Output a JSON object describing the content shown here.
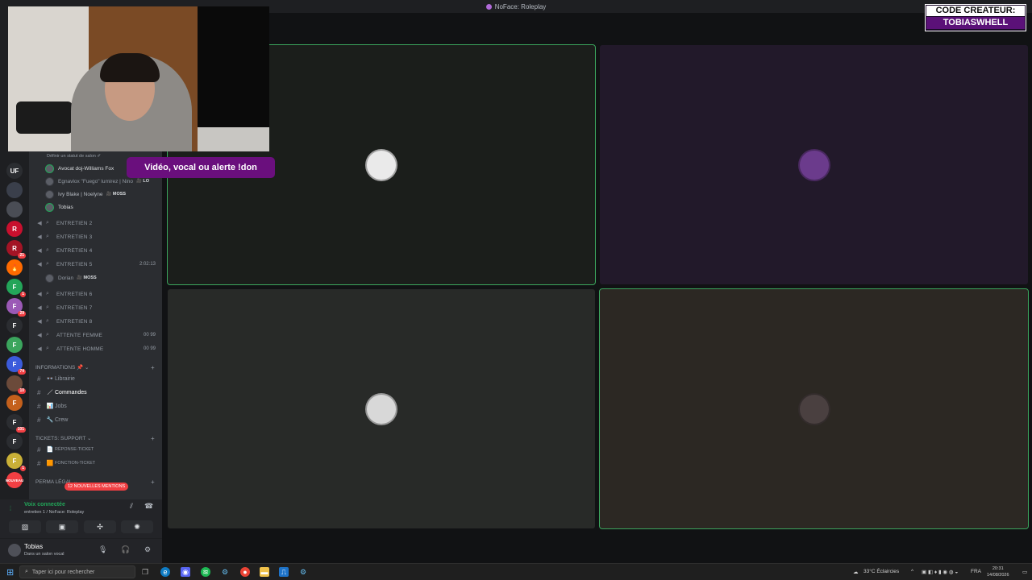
{
  "window": {
    "title": "NoFace: Roleplay"
  },
  "overlay": {
    "alert_text": "Vidéo, vocal ou alerte !don",
    "code_line1": "CODE CREATEUR:",
    "code_line2": "TOBIASWHELL"
  },
  "servers": [
    {
      "label": "UF",
      "color": "#2b2d31",
      "badge": ""
    },
    {
      "label": "",
      "color": "#3a3f4b",
      "badge": ""
    },
    {
      "label": "",
      "color": "#4a4d55",
      "badge": ""
    },
    {
      "label": "R",
      "color": "#c8102e",
      "badge": ""
    },
    {
      "label": "R",
      "color": "#a31425",
      "badge": "21"
    },
    {
      "label": "🔥",
      "color": "#ff6a00",
      "badge": ""
    },
    {
      "label": "F",
      "color": "#23a559",
      "badge": "1"
    },
    {
      "label": "F",
      "color": "#9b59b6",
      "badge": "29"
    },
    {
      "label": "F",
      "color": "#2b2d31",
      "badge": ""
    },
    {
      "label": "F",
      "color": "#3ba55d",
      "badge": ""
    },
    {
      "label": "F",
      "color": "#3b5bdb",
      "badge": "74"
    },
    {
      "label": "",
      "color": "#6b4a3a",
      "badge": "10"
    },
    {
      "label": "F",
      "color": "#c4601c",
      "badge": ""
    },
    {
      "label": "F",
      "color": "#2b2d31",
      "badge": "101"
    },
    {
      "label": "F",
      "color": "#2b2d31",
      "badge": ""
    },
    {
      "label": "F",
      "color": "#c9b037",
      "badge": "1"
    },
    {
      "label": "NOUVEAU",
      "color": "#f23f43",
      "badge": ""
    }
  ],
  "sidebar": {
    "status_prompt": "Définir un statut de salon ✐",
    "members_top": [
      {
        "name": "Avocat doj-Williams Fox",
        "tag": ""
      },
      {
        "name": "Egnavlox \"Fuego\" lumirez | Nino",
        "tag": "🎥 LO"
      },
      {
        "name": "Ivy Blake | Noelyne",
        "tag": "🎥 MOSS"
      },
      {
        "name": "Tobias",
        "tag": ""
      }
    ],
    "voice_channels": [
      {
        "name": "ENTRETIEN 2",
        "right": ""
      },
      {
        "name": "ENTRETIEN 3",
        "right": ""
      },
      {
        "name": "ENTRETIEN 4",
        "right": ""
      },
      {
        "name": "ENTRETIEN 5",
        "right": "2:02:13"
      }
    ],
    "entretien5_member": {
      "name": "Dorian",
      "tag": "🎥 MOSS"
    },
    "voice_channels_2": [
      {
        "name": "ENTRETIEN 6",
        "right": ""
      },
      {
        "name": "ENTRETIEN 7",
        "right": ""
      },
      {
        "name": "ENTRETIEN 8",
        "right": ""
      },
      {
        "name": "ATTENTE FEMME",
        "right": "00 99"
      },
      {
        "name": "ATTENTE HOMME",
        "right": "00 99"
      }
    ],
    "cat_informations": "INFORMATIONS 📌 ⌄",
    "info_channels": [
      {
        "name": "Librairie",
        "emoji": "👓",
        "active": false
      },
      {
        "name": "Commandes",
        "emoji": "／",
        "active": true
      },
      {
        "name": "Jobs",
        "emoji": "📊",
        "active": false
      },
      {
        "name": "Crew",
        "emoji": "🔧",
        "active": false
      }
    ],
    "cat_tickets": "TICKETS: SUPPORT ⌄",
    "ticket_channels": [
      {
        "name": "RÉPONSE-TICKET",
        "emoji": "📄"
      },
      {
        "name": "FONCTION-TICKET",
        "emoji": "🟧"
      }
    ],
    "cat_perma": "PERMA LÉGAL ⌄",
    "mentions_pill": "12 NOUVELLES MENTIONS"
  },
  "voice_panel": {
    "connected": "Voix connectée",
    "server_line": "entretien 1 / NoFace: Roleplay"
  },
  "user_panel": {
    "name": "Tobias",
    "status": "Dans un salon vocal"
  },
  "tiles": [
    {
      "color": "#1b1e1b",
      "speaking": true,
      "avatar": "#eaeaea"
    },
    {
      "color": "#22192a",
      "speaking": false,
      "avatar": "#6b3b8c"
    },
    {
      "color": "#282a28",
      "speaking": false,
      "avatar": "#d8d8d8"
    },
    {
      "color": "#2c2823",
      "speaking": true,
      "avatar": "#4a4040"
    }
  ],
  "taskbar": {
    "search_placeholder": "Taper ici pour rechercher",
    "weather": "33°C  Éclaircies",
    "lang": "FRA",
    "time": "20:31",
    "date": "14/08/2026"
  }
}
